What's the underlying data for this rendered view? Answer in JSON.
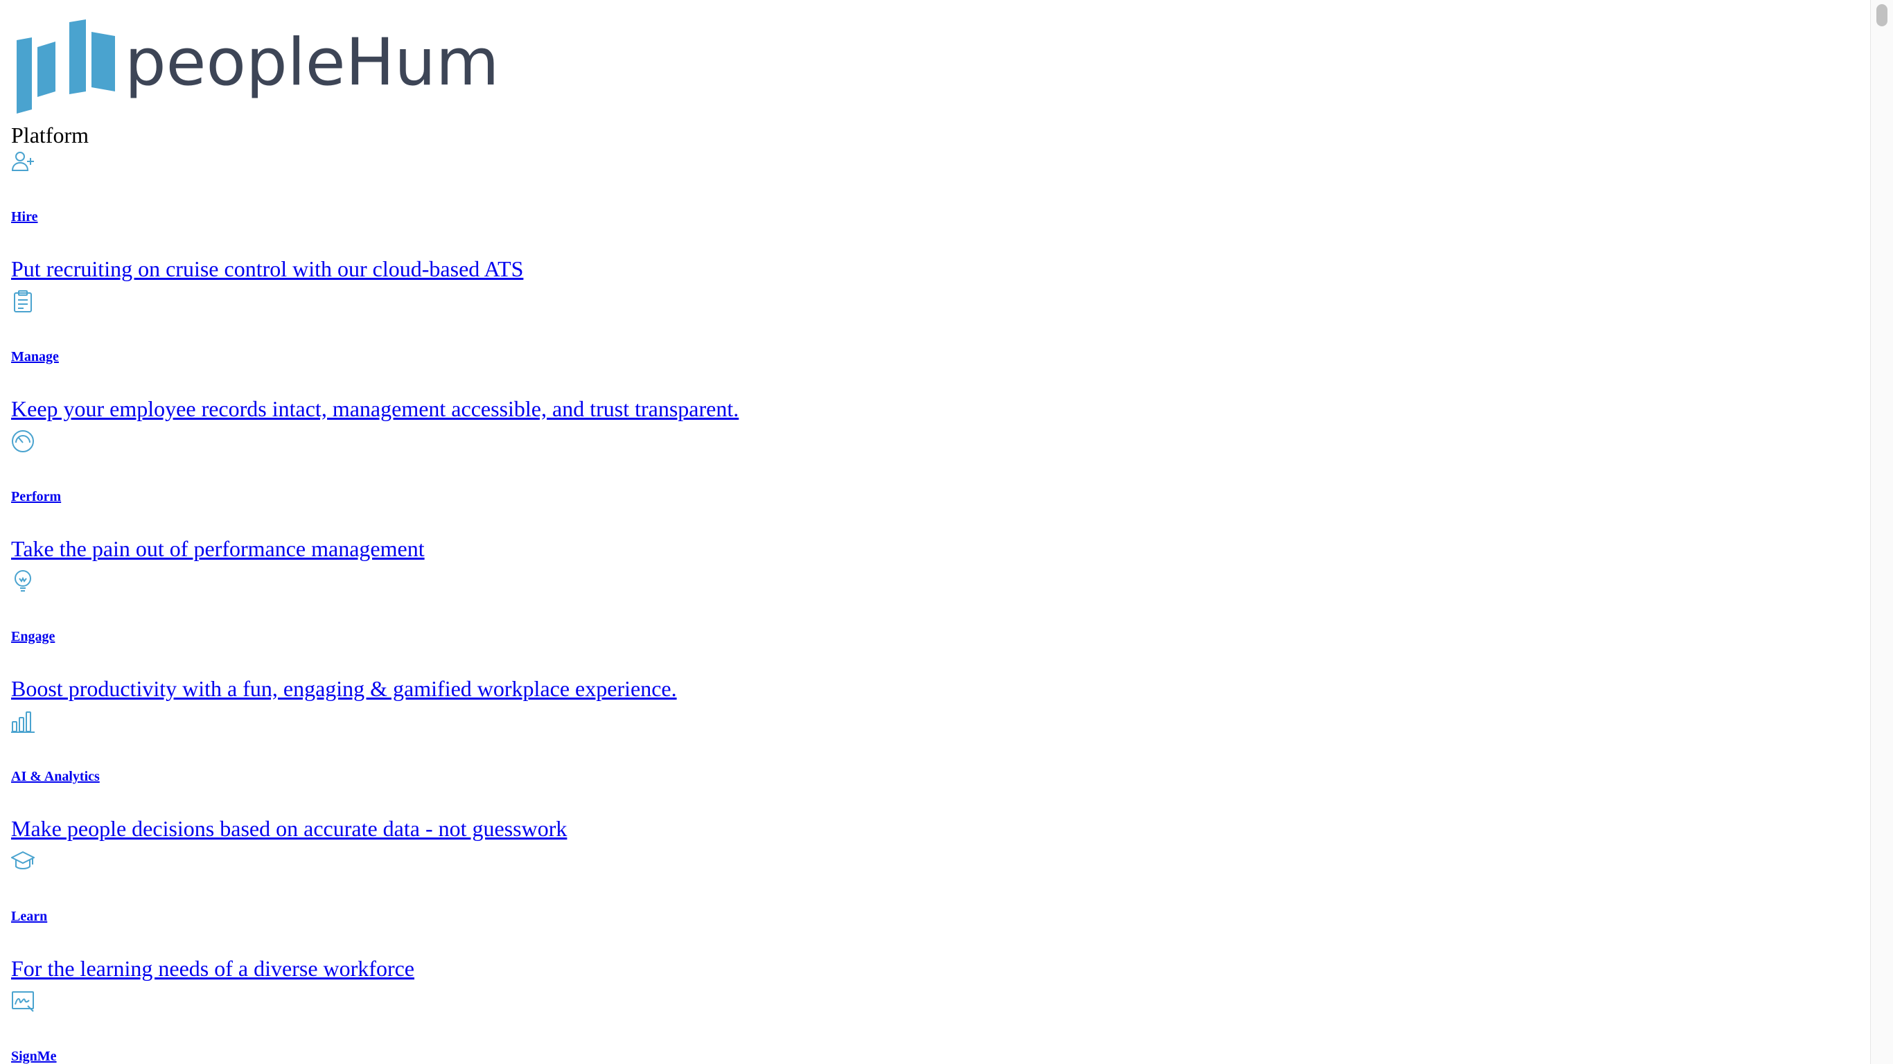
{
  "brand": {
    "name": "peopleHum",
    "color": "#4aa3cf",
    "text_color": "#3d4556"
  },
  "nav": {
    "heading": "Platform",
    "items": [
      {
        "icon": "user-plus-icon",
        "title": "Hire",
        "description": "Put recruiting on cruise control with our cloud-based ATS "
      },
      {
        "icon": "clipboard-icon",
        "title": "Manage",
        "description": "Keep your employee records intact, management accessible, and trust transparent."
      },
      {
        "icon": "gauge-icon",
        "title": "Perform",
        "description": "Take the pain out of performance management"
      },
      {
        "icon": "lightbulb-icon",
        "title": "Engage",
        "description": "Boost productivity with a fun, engaging & gamified workplace experience."
      },
      {
        "icon": "bar-chart-icon",
        "title": "AI & Analytics",
        "description": "Make people decisions based on accurate data - not guesswork"
      },
      {
        "icon": "graduation-cap-icon",
        "title": "Learn",
        "description": "For the learning needs of a diverse workforce"
      },
      {
        "icon": "signature-icon",
        "title": "SignMe",
        "description": ""
      }
    ]
  },
  "colors": {
    "link": "#0000ee",
    "icon": "#4aa3cf"
  }
}
